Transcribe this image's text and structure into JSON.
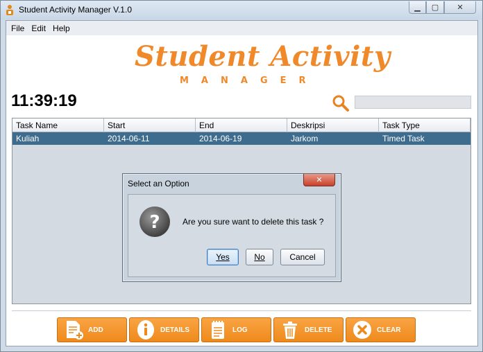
{
  "window": {
    "title": "Student Activity Manager V.1.0",
    "minimize_glyph": "▁",
    "maximize_glyph": "▢",
    "close_glyph": "✕"
  },
  "menu": {
    "items": [
      "File",
      "Edit",
      "Help"
    ]
  },
  "logo": {
    "title": "Student Activity",
    "subtitle": "MANAGER"
  },
  "clock": "11:39:19",
  "search": {
    "value": "",
    "placeholder": ""
  },
  "table": {
    "columns": [
      "Task Name",
      "Start",
      "End",
      "Deskripsi",
      "Task Type"
    ],
    "rows": [
      [
        "Kuliah",
        "2014-06-11",
        "2014-06-19",
        "Jarkom",
        "Timed Task"
      ]
    ]
  },
  "buttons": {
    "add": "ADD",
    "details": "DETAILS",
    "log": "LOG",
    "delete": "DELETE",
    "clear": "CLEAR"
  },
  "dialog": {
    "title": "Select an Option",
    "close_glyph": "✕",
    "message": "Are you sure want to delete this task ?",
    "yes": "Yes",
    "no": "No",
    "cancel": "Cancel"
  },
  "colors": {
    "accent_orange": "#f0892a",
    "selected_row": "#3e6c8f"
  }
}
